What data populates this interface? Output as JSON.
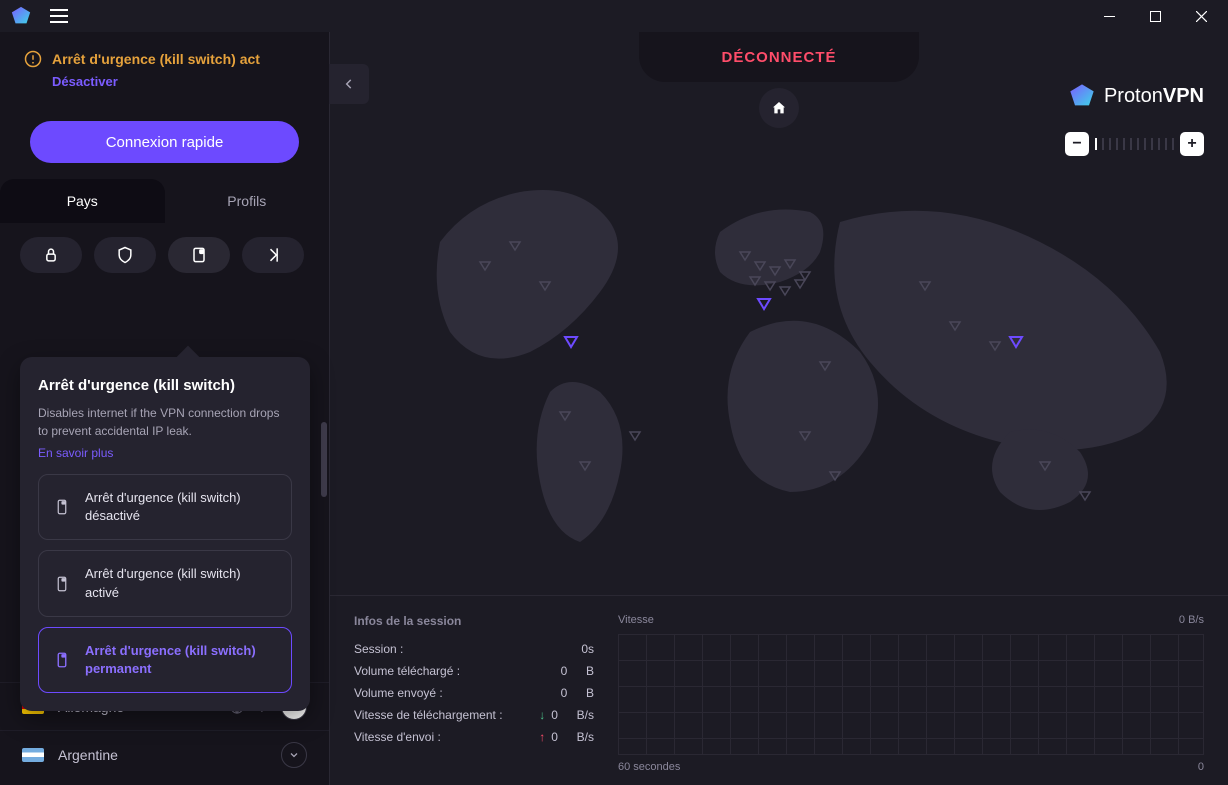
{
  "status": {
    "label": "DÉCONNECTÉ"
  },
  "brand": {
    "name1": "Proton",
    "name2": "VPN"
  },
  "warning": {
    "text": "Arrêt d'urgence (kill switch) act",
    "disable": "Désactiver"
  },
  "quick_connect": {
    "label": "Connexion rapide"
  },
  "tabs": {
    "countries": "Pays",
    "profiles": "Profils"
  },
  "feature_popup": {
    "title": "Arrêt d'urgence (kill switch)",
    "description": "Disables internet if the VPN connection drops to prevent accidental IP leak.",
    "learn_more": "En savoir plus",
    "options": [
      {
        "label": "Arrêt d'urgence (kill switch) désactivé",
        "selected": false
      },
      {
        "label": "Arrêt d'urgence (kill switch) activé",
        "selected": false
      },
      {
        "label": "Arrêt d'urgence (kill switch) permanent",
        "selected": true
      }
    ]
  },
  "countries": [
    {
      "name": "Allemagne",
      "flag": "de",
      "has_p2p": true
    },
    {
      "name": "Argentine",
      "flag": "ar",
      "has_p2p": false
    }
  ],
  "session": {
    "title": "Infos de la session",
    "rows": [
      {
        "label": "Session :",
        "value": "0s",
        "unit": ""
      },
      {
        "label": "Volume téléchargé :",
        "value": "0",
        "unit": "B"
      },
      {
        "label": "Volume envoyé :",
        "value": "0",
        "unit": "B"
      },
      {
        "label": "Vitesse de téléchargement :",
        "value": "0",
        "unit": "B/s",
        "arrow": "down"
      },
      {
        "label": "Vitesse d'envoi :",
        "value": "0",
        "unit": "B/s",
        "arrow": "up"
      }
    ]
  },
  "chart": {
    "left_label": "Vitesse",
    "right_label": "0  B/s",
    "bottom_left": "60 secondes",
    "bottom_right": "0"
  }
}
